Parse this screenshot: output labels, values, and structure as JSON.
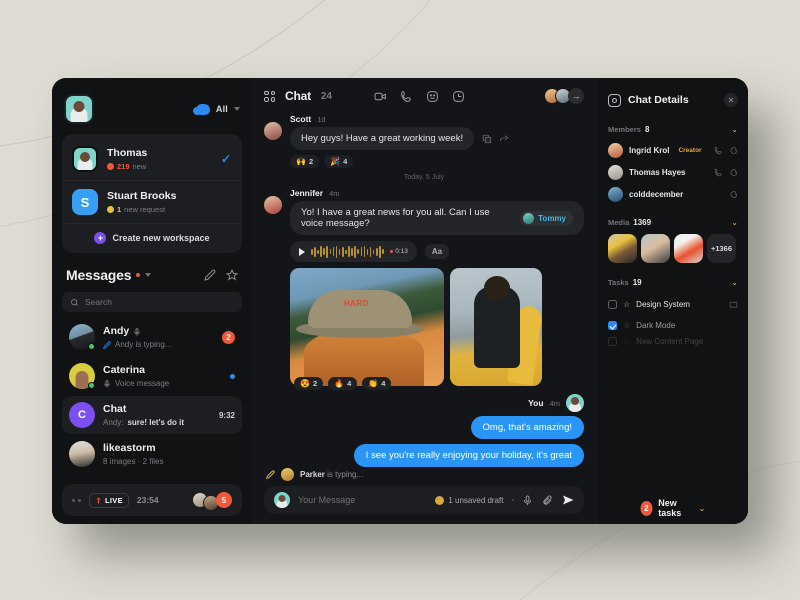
{
  "sidebar": {
    "filter_label": "All",
    "workspaces": [
      {
        "name": "Thomas",
        "meta_count": "219",
        "meta_text": "new",
        "initial": "",
        "selected": true
      },
      {
        "name": "Stuart Brooks",
        "meta_count": "1",
        "meta_text": "new request",
        "initial": "S",
        "selected": false
      }
    ],
    "create_workspace": "Create new workspace",
    "messages_title": "Messages",
    "search_placeholder": "Search",
    "chats": [
      {
        "name": "Andy",
        "sub": "Andy is typing...",
        "sub_prefix": "",
        "badge": "2",
        "time": "",
        "active": false
      },
      {
        "name": "Caterina",
        "sub": "Voice message",
        "sub_prefix": "",
        "badge": "",
        "time": "",
        "active": false
      },
      {
        "name": "Chat",
        "sub": "sure! let's do it",
        "sub_prefix": "Andy:",
        "badge": "",
        "time": "9:32",
        "active": true
      },
      {
        "name": "likeastorm",
        "sub": "8 images  ·  2 files",
        "sub_prefix": "",
        "badge": "",
        "time": "",
        "active": false
      }
    ],
    "live": {
      "label": "LIVE",
      "time": "23:54",
      "count": "5"
    }
  },
  "center": {
    "title": "Chat",
    "count": "24",
    "messages": [
      {
        "author": "Scott",
        "time": "1d",
        "text": "Hey guys! Have a great working week!",
        "reactions": [
          {
            "emoji": "🙌",
            "count": "2"
          },
          {
            "emoji": "🎉",
            "count": "4"
          }
        ]
      },
      {
        "author": "Jennifer",
        "time": "4m",
        "text": "Yo! I have a great news for you all. Can I use voice message?",
        "mention": "Tommy",
        "voice_duration": "0:13",
        "format_button": "Aa",
        "reactions": [
          {
            "emoji": "😍",
            "count": "2"
          },
          {
            "emoji": "🔥",
            "count": "4"
          },
          {
            "emoji": "👏",
            "count": "4"
          }
        ]
      }
    ],
    "day_separator": "Today, 5 July",
    "you_label": "You",
    "you_time": "4m",
    "own_messages": [
      "Omg, that's amazing!",
      "I see you're really enjoying your holiday, it's great"
    ],
    "typing": {
      "name": "Parker",
      "text": "is typing..."
    },
    "composer": {
      "placeholder": "Your Message",
      "draft": "1 unsaved draft"
    }
  },
  "details": {
    "title": "Chat Details",
    "members_label": "Members",
    "members_count": "8",
    "members": [
      {
        "name": "Ingrid Krol",
        "tag": "Creator",
        "has_call": true
      },
      {
        "name": "Thomas Hayes",
        "tag": "",
        "has_call": true
      },
      {
        "name": "colddecember",
        "tag": "",
        "has_call": false
      }
    ],
    "media_label": "Media",
    "media_count": "1369",
    "media_more": "+1366",
    "tasks_label": "Tasks",
    "tasks_count": "19",
    "tasks": [
      {
        "label": "Design System",
        "done": false,
        "starred": true
      },
      {
        "label": "Dark Mode",
        "done": true,
        "starred": false
      },
      {
        "label": "New Content Page",
        "done": false,
        "starred": false
      }
    ],
    "new_tasks_badge": "2",
    "new_tasks_label": "New tasks"
  },
  "colors": {
    "accent_blue": "#2a95f5",
    "accent_orange": "#f0583c",
    "accent_purple": "#7b4ff0",
    "accent_yellow": "#d8c06a",
    "bg_page": "#dddbd2",
    "bg_window": "#111214"
  }
}
